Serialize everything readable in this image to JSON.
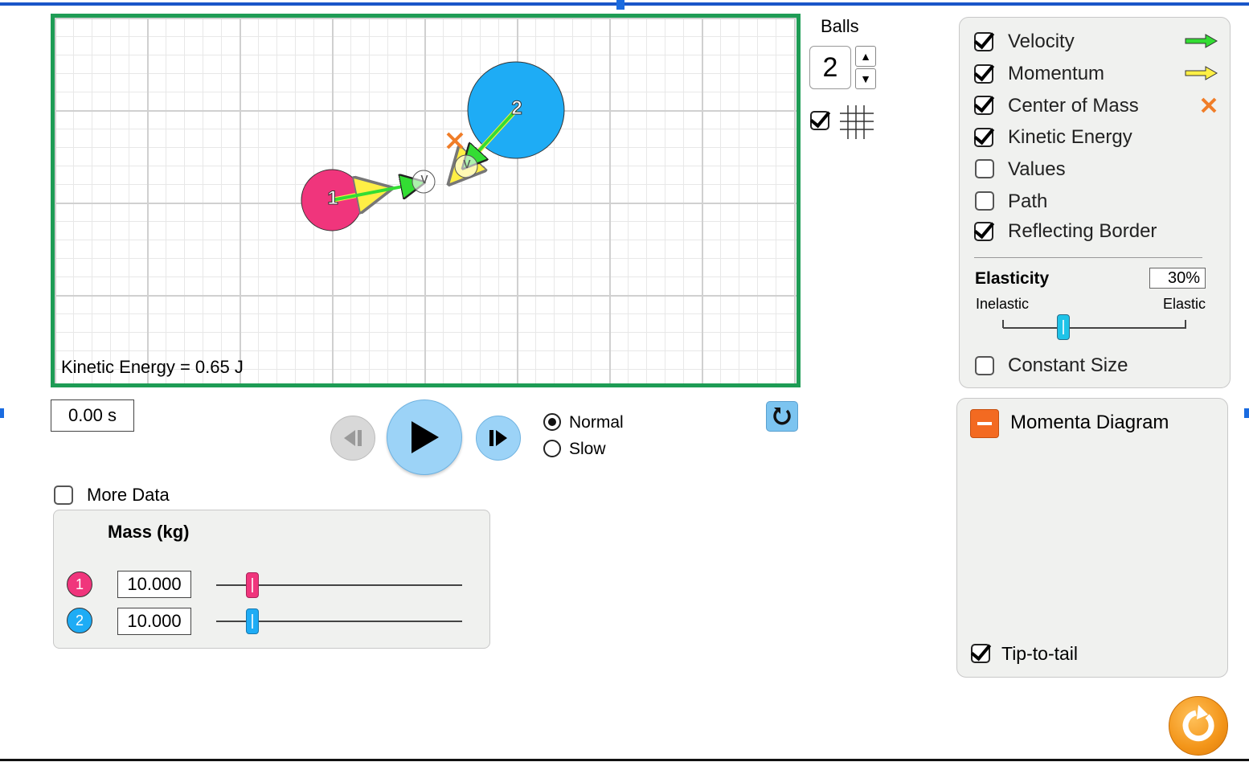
{
  "play_area": {
    "kinetic_energy_label": "Kinetic Energy = 0.65 J",
    "balls": [
      {
        "label": "1",
        "color": "#f0357c"
      },
      {
        "label": "2",
        "color": "#1eacf5"
      }
    ],
    "velocity_marker": "v",
    "center_of_mass_marker": "×"
  },
  "balls_control": {
    "title": "Balls",
    "count": "2",
    "up_icon": "up-triangle-icon",
    "down_icon": "down-triangle-icon",
    "grid_checked": true
  },
  "options": {
    "items": [
      {
        "label": "Velocity",
        "checked": true,
        "legend": "green-arrow-icon"
      },
      {
        "label": "Momentum",
        "checked": true,
        "legend": "yellow-arrow-icon"
      },
      {
        "label": "Center of Mass",
        "checked": true,
        "legend": "orange-x-icon"
      },
      {
        "label": "Kinetic Energy",
        "checked": true
      },
      {
        "label": "Values",
        "checked": false
      },
      {
        "label": "Path",
        "checked": false
      },
      {
        "label": "Reflecting Border",
        "checked": true
      }
    ],
    "elasticity": {
      "title": "Elasticity",
      "value": "30%",
      "min_label": "Inelastic",
      "max_label": "Elastic",
      "fraction": 0.3
    },
    "constant_size": {
      "label": "Constant Size",
      "checked": false
    }
  },
  "transport": {
    "time": "0.00 s",
    "speed_options": [
      {
        "label": "Normal",
        "selected": true
      },
      {
        "label": "Slow",
        "selected": false
      }
    ]
  },
  "more_data": {
    "label": "More Data",
    "checked": false
  },
  "mass_panel": {
    "title": "Mass (kg)",
    "rows": [
      {
        "ball": "1",
        "value": "10.000",
        "color": "#f0357c"
      },
      {
        "ball": "2",
        "value": "10.000",
        "color": "#1eacf5"
      }
    ]
  },
  "momenta": {
    "title": "Momenta Diagram",
    "tip_to_tail": {
      "label": "Tip-to-tail",
      "checked": true
    }
  },
  "colors": {
    "border": "#1e9c55",
    "velocity": "#33dd33",
    "momentum": "#ffef45",
    "center_of_mass": "#f07d28",
    "button_blue": "#9cd3f7"
  }
}
